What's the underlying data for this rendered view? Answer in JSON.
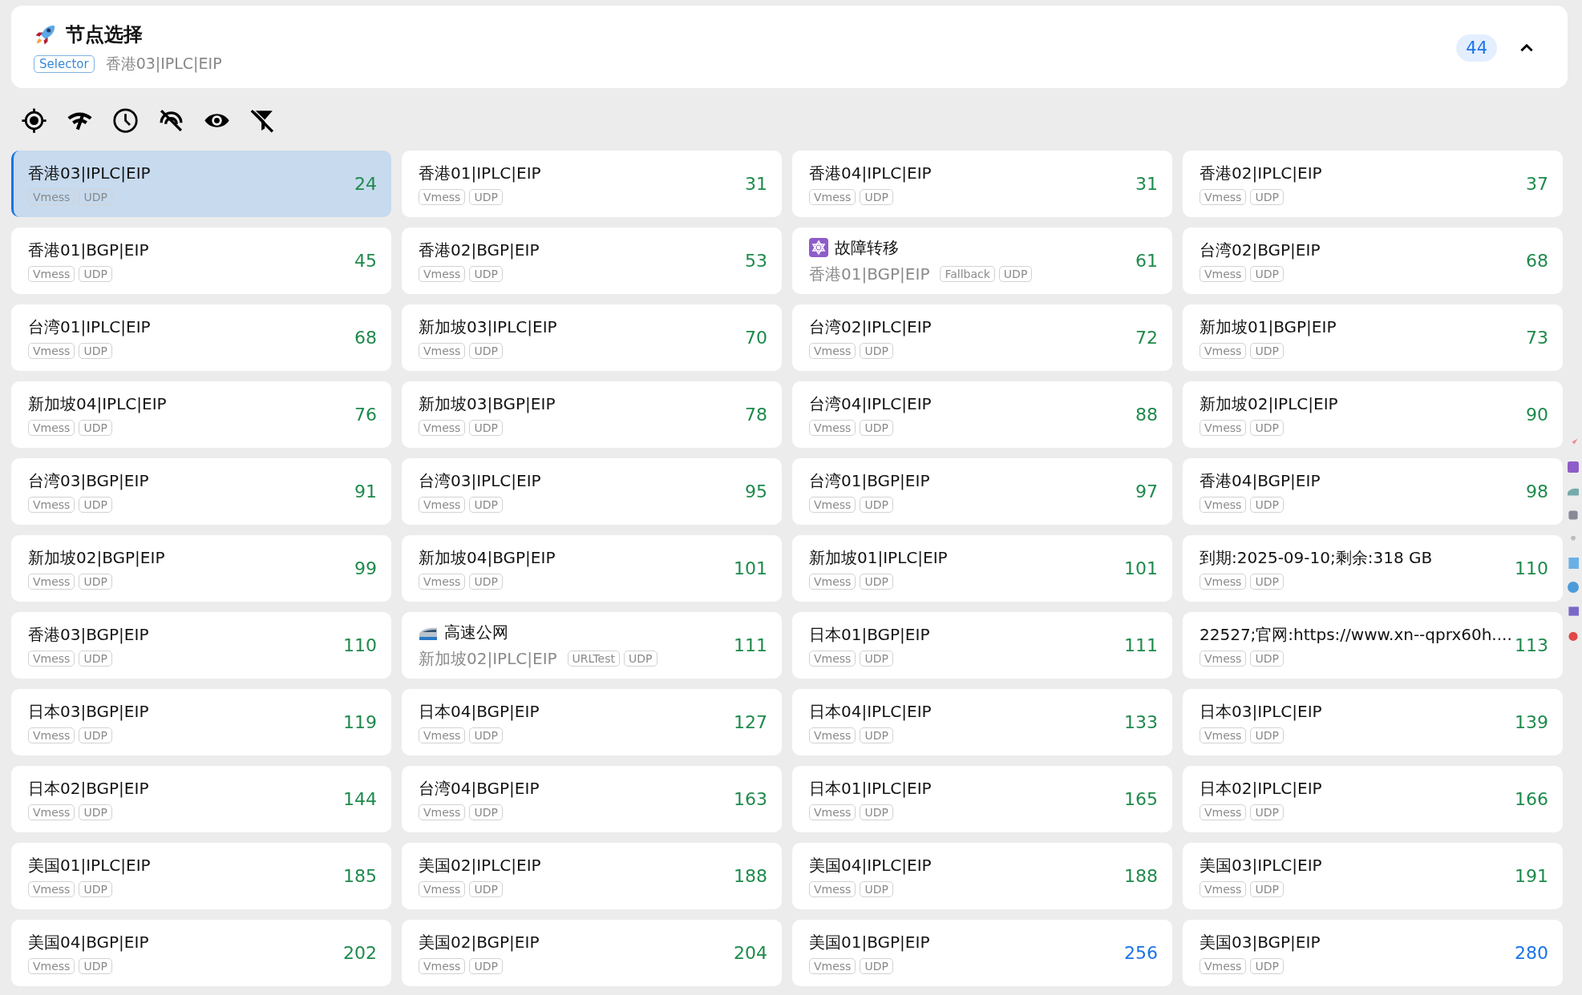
{
  "group": {
    "title": "节点选择",
    "type": "Selector",
    "now": "香港03|IPLC|EIP",
    "count": "44",
    "expanded": true
  },
  "nodes": [
    {
      "name": "香港03|IPLC|EIP",
      "tags": [
        "Vmess",
        "UDP"
      ],
      "delay": "24",
      "color": "#1e8a4c",
      "selected": true
    },
    {
      "name": "香港01|IPLC|EIP",
      "tags": [
        "Vmess",
        "UDP"
      ],
      "delay": "31",
      "color": "#1e8a4c",
      "selected": false
    },
    {
      "name": "香港04|IPLC|EIP",
      "tags": [
        "Vmess",
        "UDP"
      ],
      "delay": "31",
      "color": "#1e8a4c",
      "selected": false
    },
    {
      "name": "香港02|IPLC|EIP",
      "tags": [
        "Vmess",
        "UDP"
      ],
      "delay": "37",
      "color": "#1e8a4c",
      "selected": false
    },
    {
      "name": "香港01|BGP|EIP",
      "tags": [
        "Vmess",
        "UDP"
      ],
      "delay": "45",
      "color": "#1e8a4c",
      "selected": false
    },
    {
      "name": "香港02|BGP|EIP",
      "tags": [
        "Vmess",
        "UDP"
      ],
      "delay": "53",
      "color": "#1e8a4c",
      "selected": false
    },
    {
      "name": "故障转移",
      "kind": "fallback",
      "now": "香港01|BGP|EIP",
      "tags": [
        "Fallback",
        "UDP"
      ],
      "delay": "61",
      "color": "#1e8a4c",
      "selected": false
    },
    {
      "name": "台湾02|BGP|EIP",
      "tags": [
        "Vmess",
        "UDP"
      ],
      "delay": "68",
      "color": "#1e8a4c",
      "selected": false
    },
    {
      "name": "台湾01|IPLC|EIP",
      "tags": [
        "Vmess",
        "UDP"
      ],
      "delay": "68",
      "color": "#1e8a4c",
      "selected": false
    },
    {
      "name": "新加坡03|IPLC|EIP",
      "tags": [
        "Vmess",
        "UDP"
      ],
      "delay": "70",
      "color": "#1e8a4c",
      "selected": false
    },
    {
      "name": "台湾02|IPLC|EIP",
      "tags": [
        "Vmess",
        "UDP"
      ],
      "delay": "72",
      "color": "#1e8a4c",
      "selected": false
    },
    {
      "name": "新加坡01|BGP|EIP",
      "tags": [
        "Vmess",
        "UDP"
      ],
      "delay": "73",
      "color": "#1e8a4c",
      "selected": false
    },
    {
      "name": "新加坡04|IPLC|EIP",
      "tags": [
        "Vmess",
        "UDP"
      ],
      "delay": "76",
      "color": "#1e8a4c",
      "selected": false
    },
    {
      "name": "新加坡03|BGP|EIP",
      "tags": [
        "Vmess",
        "UDP"
      ],
      "delay": "78",
      "color": "#1e8a4c",
      "selected": false
    },
    {
      "name": "台湾04|IPLC|EIP",
      "tags": [
        "Vmess",
        "UDP"
      ],
      "delay": "88",
      "color": "#1e8a4c",
      "selected": false
    },
    {
      "name": "新加坡02|IPLC|EIP",
      "tags": [
        "Vmess",
        "UDP"
      ],
      "delay": "90",
      "color": "#1e8a4c",
      "selected": false
    },
    {
      "name": "台湾03|BGP|EIP",
      "tags": [
        "Vmess",
        "UDP"
      ],
      "delay": "91",
      "color": "#1e8a4c",
      "selected": false
    },
    {
      "name": "台湾03|IPLC|EIP",
      "tags": [
        "Vmess",
        "UDP"
      ],
      "delay": "95",
      "color": "#1e8a4c",
      "selected": false
    },
    {
      "name": "台湾01|BGP|EIP",
      "tags": [
        "Vmess",
        "UDP"
      ],
      "delay": "97",
      "color": "#1e8a4c",
      "selected": false
    },
    {
      "name": "香港04|BGP|EIP",
      "tags": [
        "Vmess",
        "UDP"
      ],
      "delay": "98",
      "color": "#1e8a4c",
      "selected": false
    },
    {
      "name": "新加坡02|BGP|EIP",
      "tags": [
        "Vmess",
        "UDP"
      ],
      "delay": "99",
      "color": "#1e8a4c",
      "selected": false
    },
    {
      "name": "新加坡04|BGP|EIP",
      "tags": [
        "Vmess",
        "UDP"
      ],
      "delay": "101",
      "color": "#1e8a4c",
      "selected": false
    },
    {
      "name": "新加坡01|IPLC|EIP",
      "tags": [
        "Vmess",
        "UDP"
      ],
      "delay": "101",
      "color": "#1e8a4c",
      "selected": false
    },
    {
      "name": "到期:2025-09-10;剩余:318 GB",
      "tags": [
        "Vmess",
        "UDP"
      ],
      "delay": "110",
      "color": "#1e8a4c",
      "selected": false
    },
    {
      "name": "香港03|BGP|EIP",
      "tags": [
        "Vmess",
        "UDP"
      ],
      "delay": "110",
      "color": "#1e8a4c",
      "selected": false
    },
    {
      "name": "高速公网",
      "kind": "urltest",
      "now": "新加坡02|IPLC|EIP",
      "tags": [
        "URLTest",
        "UDP"
      ],
      "delay": "111",
      "color": "#1e8a4c",
      "selected": false
    },
    {
      "name": "日本01|BGP|EIP",
      "tags": [
        "Vmess",
        "UDP"
      ],
      "delay": "111",
      "color": "#1e8a4c",
      "selected": false
    },
    {
      "name": "22527;官网:https://www.xn--qprx60h....",
      "tags": [
        "Vmess",
        "UDP"
      ],
      "delay": "113",
      "color": "#1e8a4c",
      "selected": false
    },
    {
      "name": "日本03|BGP|EIP",
      "tags": [
        "Vmess",
        "UDP"
      ],
      "delay": "119",
      "color": "#1e8a4c",
      "selected": false
    },
    {
      "name": "日本04|BGP|EIP",
      "tags": [
        "Vmess",
        "UDP"
      ],
      "delay": "127",
      "color": "#1e8a4c",
      "selected": false
    },
    {
      "name": "日本04|IPLC|EIP",
      "tags": [
        "Vmess",
        "UDP"
      ],
      "delay": "133",
      "color": "#1e8a4c",
      "selected": false
    },
    {
      "name": "日本03|IPLC|EIP",
      "tags": [
        "Vmess",
        "UDP"
      ],
      "delay": "139",
      "color": "#1e8a4c",
      "selected": false
    },
    {
      "name": "日本02|BGP|EIP",
      "tags": [
        "Vmess",
        "UDP"
      ],
      "delay": "144",
      "color": "#1e8a4c",
      "selected": false
    },
    {
      "name": "台湾04|BGP|EIP",
      "tags": [
        "Vmess",
        "UDP"
      ],
      "delay": "163",
      "color": "#1e8a4c",
      "selected": false
    },
    {
      "name": "日本01|IPLC|EIP",
      "tags": [
        "Vmess",
        "UDP"
      ],
      "delay": "165",
      "color": "#1e8a4c",
      "selected": false
    },
    {
      "name": "日本02|IPLC|EIP",
      "tags": [
        "Vmess",
        "UDP"
      ],
      "delay": "166",
      "color": "#1e8a4c",
      "selected": false
    },
    {
      "name": "美国01|IPLC|EIP",
      "tags": [
        "Vmess",
        "UDP"
      ],
      "delay": "185",
      "color": "#1e8a4c",
      "selected": false
    },
    {
      "name": "美国02|IPLC|EIP",
      "tags": [
        "Vmess",
        "UDP"
      ],
      "delay": "188",
      "color": "#1e8a4c",
      "selected": false
    },
    {
      "name": "美国04|IPLC|EIP",
      "tags": [
        "Vmess",
        "UDP"
      ],
      "delay": "188",
      "color": "#1e8a4c",
      "selected": false
    },
    {
      "name": "美国03|IPLC|EIP",
      "tags": [
        "Vmess",
        "UDP"
      ],
      "delay": "191",
      "color": "#1e8a4c",
      "selected": false
    },
    {
      "name": "美国04|BGP|EIP",
      "tags": [
        "Vmess",
        "UDP"
      ],
      "delay": "202",
      "color": "#1e8a4c",
      "selected": false
    },
    {
      "name": "美国02|BGP|EIP",
      "tags": [
        "Vmess",
        "UDP"
      ],
      "delay": "204",
      "color": "#1e8a4c",
      "selected": false
    },
    {
      "name": "美国01|BGP|EIP",
      "tags": [
        "Vmess",
        "UDP"
      ],
      "delay": "256",
      "color": "#1a73e8",
      "selected": false
    },
    {
      "name": "美国03|BGP|EIP",
      "tags": [
        "Vmess",
        "UDP"
      ],
      "delay": "280",
      "color": "#1a73e8",
      "selected": false
    }
  ]
}
